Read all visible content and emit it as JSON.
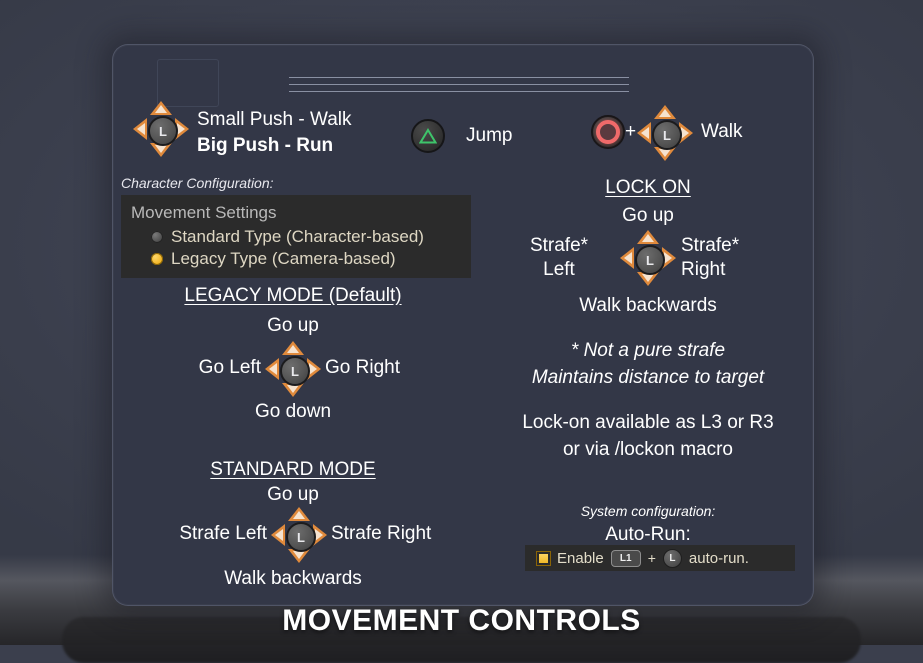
{
  "title": "MOVEMENT CONTROLS",
  "left_column": {
    "stick_note_line1": "Small Push - Walk",
    "stick_note_line2": "Big Push - Run",
    "config_caption": "Character Configuration:",
    "settings": {
      "heading": "Movement Settings",
      "options": [
        {
          "label": "Standard Type (Character-based)",
          "selected": false
        },
        {
          "label": "Legacy Type (Camera-based)",
          "selected": true
        }
      ]
    },
    "legacy": {
      "heading": "LEGACY MODE (Default)",
      "up": "Go up",
      "left": "Go Left",
      "right": "Go Right",
      "down": "Go down"
    },
    "standard": {
      "heading": "STANDARD MODE",
      "up": "Go up",
      "left": "Strafe Left",
      "right": "Strafe Right",
      "down": "Walk backwards"
    }
  },
  "middle_column": {
    "jump_label": "Jump",
    "jump_icon": "triangle-button-green"
  },
  "right_column": {
    "walk_plus": "+",
    "walk_label": "Walk",
    "walk_icon": "circle-button-red",
    "lockon": {
      "heading": "LOCK ON",
      "up": "Go up",
      "left_line1": "Strafe*",
      "left_line2": "Left",
      "right_line1": "Strafe*",
      "right_line2": "Right",
      "down": "Walk backwards"
    },
    "footnote_line1": "* Not a pure strafe",
    "footnote_line2": "Maintains distance to target",
    "lockon_info_line1": "Lock-on available as L3 or R3",
    "lockon_info_line2": "or via /lockon macro",
    "system_caption": "System configuration:",
    "autorun_heading": "Auto-Run:",
    "autorun_row": {
      "label_before": "Enable",
      "key1": "L1",
      "plus": "+",
      "key2": "L",
      "label_after": "auto-run."
    }
  },
  "stick_glyph": "L",
  "colors": {
    "accent_orange": "#e08a3c",
    "accent_orange_light": "#f6e3cf",
    "selected_radio": "#f0b21f",
    "jump_green": "#3ec46a",
    "circle_red": "#f06a6a",
    "card_bg": "#333747",
    "panel_bg": "#2b2b2b"
  }
}
